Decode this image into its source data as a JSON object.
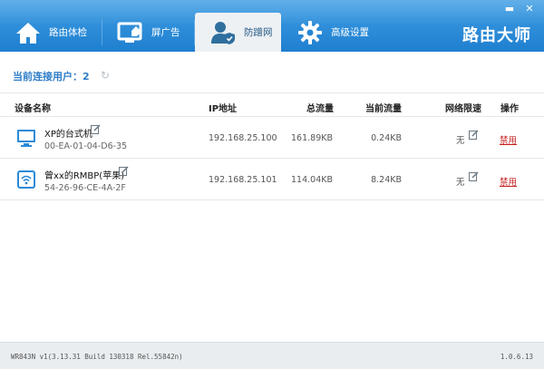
{
  "window": {
    "minimize": "▬",
    "close": "✕"
  },
  "tabs": [
    {
      "label": "路由体检",
      "icon": "home-icon"
    },
    {
      "label": "屏广告",
      "icon": "monitor-edit-icon"
    },
    {
      "label": "防蹭网",
      "icon": "user-shield-icon",
      "active": true
    },
    {
      "label": "高级设置",
      "icon": "gear-icon"
    }
  ],
  "brand": "路由大师",
  "main": {
    "users_label": "当前连接用户：2",
    "refresh_icon": "refresh-icon",
    "columns": {
      "device": "设备名称",
      "ip": "IP地址",
      "total": "总流量",
      "current": "当前流量",
      "limit": "网络限速",
      "action": "操作"
    },
    "devices": [
      {
        "icon": "monitor-icon",
        "name": "XP的台式机",
        "mac": "00-EA-01-04-D6-35",
        "ip": "192.168.25.100",
        "total": "161.89KB",
        "current": "0.24KB",
        "limit": "无",
        "action": "禁用"
      },
      {
        "icon": "wifi-device-icon",
        "name": "曾xx的RMBP(苹果)",
        "mac": "54-26-96-CE-4A-2F",
        "ip": "192.168.25.101",
        "total": "114.04KB",
        "current": "8.24KB",
        "limit": "无",
        "action": "禁用"
      }
    ]
  },
  "status": {
    "version_info": "WR843N v1(3.13.31 Build 130318 Rel.55842n)",
    "app_version": "1.0.6.13"
  },
  "colors": {
    "header": "#2a8ad8",
    "accent": "#2f7dc8",
    "danger": "#c51f1f"
  }
}
